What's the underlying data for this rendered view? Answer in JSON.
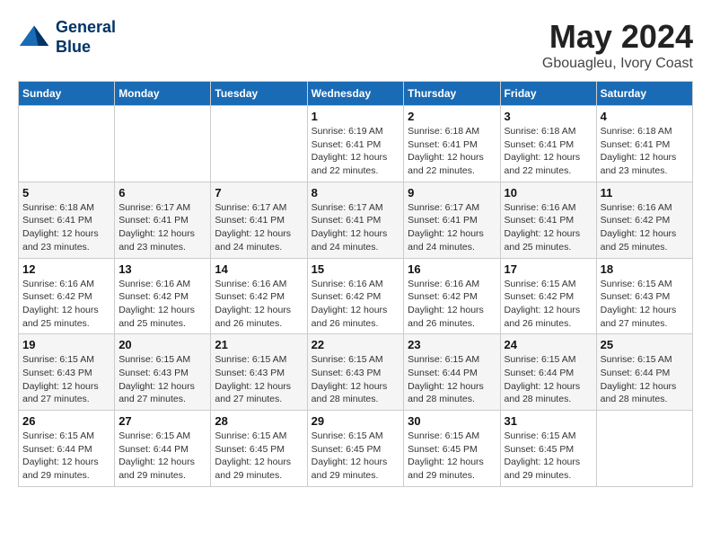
{
  "header": {
    "logo_line1": "General",
    "logo_line2": "Blue",
    "month": "May 2024",
    "location": "Gbouagleu, Ivory Coast"
  },
  "weekdays": [
    "Sunday",
    "Monday",
    "Tuesday",
    "Wednesday",
    "Thursday",
    "Friday",
    "Saturday"
  ],
  "weeks": [
    [
      {
        "day": "",
        "info": ""
      },
      {
        "day": "",
        "info": ""
      },
      {
        "day": "",
        "info": ""
      },
      {
        "day": "1",
        "info": "Sunrise: 6:19 AM\nSunset: 6:41 PM\nDaylight: 12 hours and 22 minutes."
      },
      {
        "day": "2",
        "info": "Sunrise: 6:18 AM\nSunset: 6:41 PM\nDaylight: 12 hours and 22 minutes."
      },
      {
        "day": "3",
        "info": "Sunrise: 6:18 AM\nSunset: 6:41 PM\nDaylight: 12 hours and 22 minutes."
      },
      {
        "day": "4",
        "info": "Sunrise: 6:18 AM\nSunset: 6:41 PM\nDaylight: 12 hours and 23 minutes."
      }
    ],
    [
      {
        "day": "5",
        "info": "Sunrise: 6:18 AM\nSunset: 6:41 PM\nDaylight: 12 hours and 23 minutes."
      },
      {
        "day": "6",
        "info": "Sunrise: 6:17 AM\nSunset: 6:41 PM\nDaylight: 12 hours and 23 minutes."
      },
      {
        "day": "7",
        "info": "Sunrise: 6:17 AM\nSunset: 6:41 PM\nDaylight: 12 hours and 24 minutes."
      },
      {
        "day": "8",
        "info": "Sunrise: 6:17 AM\nSunset: 6:41 PM\nDaylight: 12 hours and 24 minutes."
      },
      {
        "day": "9",
        "info": "Sunrise: 6:17 AM\nSunset: 6:41 PM\nDaylight: 12 hours and 24 minutes."
      },
      {
        "day": "10",
        "info": "Sunrise: 6:16 AM\nSunset: 6:41 PM\nDaylight: 12 hours and 25 minutes."
      },
      {
        "day": "11",
        "info": "Sunrise: 6:16 AM\nSunset: 6:42 PM\nDaylight: 12 hours and 25 minutes."
      }
    ],
    [
      {
        "day": "12",
        "info": "Sunrise: 6:16 AM\nSunset: 6:42 PM\nDaylight: 12 hours and 25 minutes."
      },
      {
        "day": "13",
        "info": "Sunrise: 6:16 AM\nSunset: 6:42 PM\nDaylight: 12 hours and 25 minutes."
      },
      {
        "day": "14",
        "info": "Sunrise: 6:16 AM\nSunset: 6:42 PM\nDaylight: 12 hours and 26 minutes."
      },
      {
        "day": "15",
        "info": "Sunrise: 6:16 AM\nSunset: 6:42 PM\nDaylight: 12 hours and 26 minutes."
      },
      {
        "day": "16",
        "info": "Sunrise: 6:16 AM\nSunset: 6:42 PM\nDaylight: 12 hours and 26 minutes."
      },
      {
        "day": "17",
        "info": "Sunrise: 6:15 AM\nSunset: 6:42 PM\nDaylight: 12 hours and 26 minutes."
      },
      {
        "day": "18",
        "info": "Sunrise: 6:15 AM\nSunset: 6:43 PM\nDaylight: 12 hours and 27 minutes."
      }
    ],
    [
      {
        "day": "19",
        "info": "Sunrise: 6:15 AM\nSunset: 6:43 PM\nDaylight: 12 hours and 27 minutes."
      },
      {
        "day": "20",
        "info": "Sunrise: 6:15 AM\nSunset: 6:43 PM\nDaylight: 12 hours and 27 minutes."
      },
      {
        "day": "21",
        "info": "Sunrise: 6:15 AM\nSunset: 6:43 PM\nDaylight: 12 hours and 27 minutes."
      },
      {
        "day": "22",
        "info": "Sunrise: 6:15 AM\nSunset: 6:43 PM\nDaylight: 12 hours and 28 minutes."
      },
      {
        "day": "23",
        "info": "Sunrise: 6:15 AM\nSunset: 6:44 PM\nDaylight: 12 hours and 28 minutes."
      },
      {
        "day": "24",
        "info": "Sunrise: 6:15 AM\nSunset: 6:44 PM\nDaylight: 12 hours and 28 minutes."
      },
      {
        "day": "25",
        "info": "Sunrise: 6:15 AM\nSunset: 6:44 PM\nDaylight: 12 hours and 28 minutes."
      }
    ],
    [
      {
        "day": "26",
        "info": "Sunrise: 6:15 AM\nSunset: 6:44 PM\nDaylight: 12 hours and 29 minutes."
      },
      {
        "day": "27",
        "info": "Sunrise: 6:15 AM\nSunset: 6:44 PM\nDaylight: 12 hours and 29 minutes."
      },
      {
        "day": "28",
        "info": "Sunrise: 6:15 AM\nSunset: 6:45 PM\nDaylight: 12 hours and 29 minutes."
      },
      {
        "day": "29",
        "info": "Sunrise: 6:15 AM\nSunset: 6:45 PM\nDaylight: 12 hours and 29 minutes."
      },
      {
        "day": "30",
        "info": "Sunrise: 6:15 AM\nSunset: 6:45 PM\nDaylight: 12 hours and 29 minutes."
      },
      {
        "day": "31",
        "info": "Sunrise: 6:15 AM\nSunset: 6:45 PM\nDaylight: 12 hours and 29 minutes."
      },
      {
        "day": "",
        "info": ""
      }
    ]
  ]
}
